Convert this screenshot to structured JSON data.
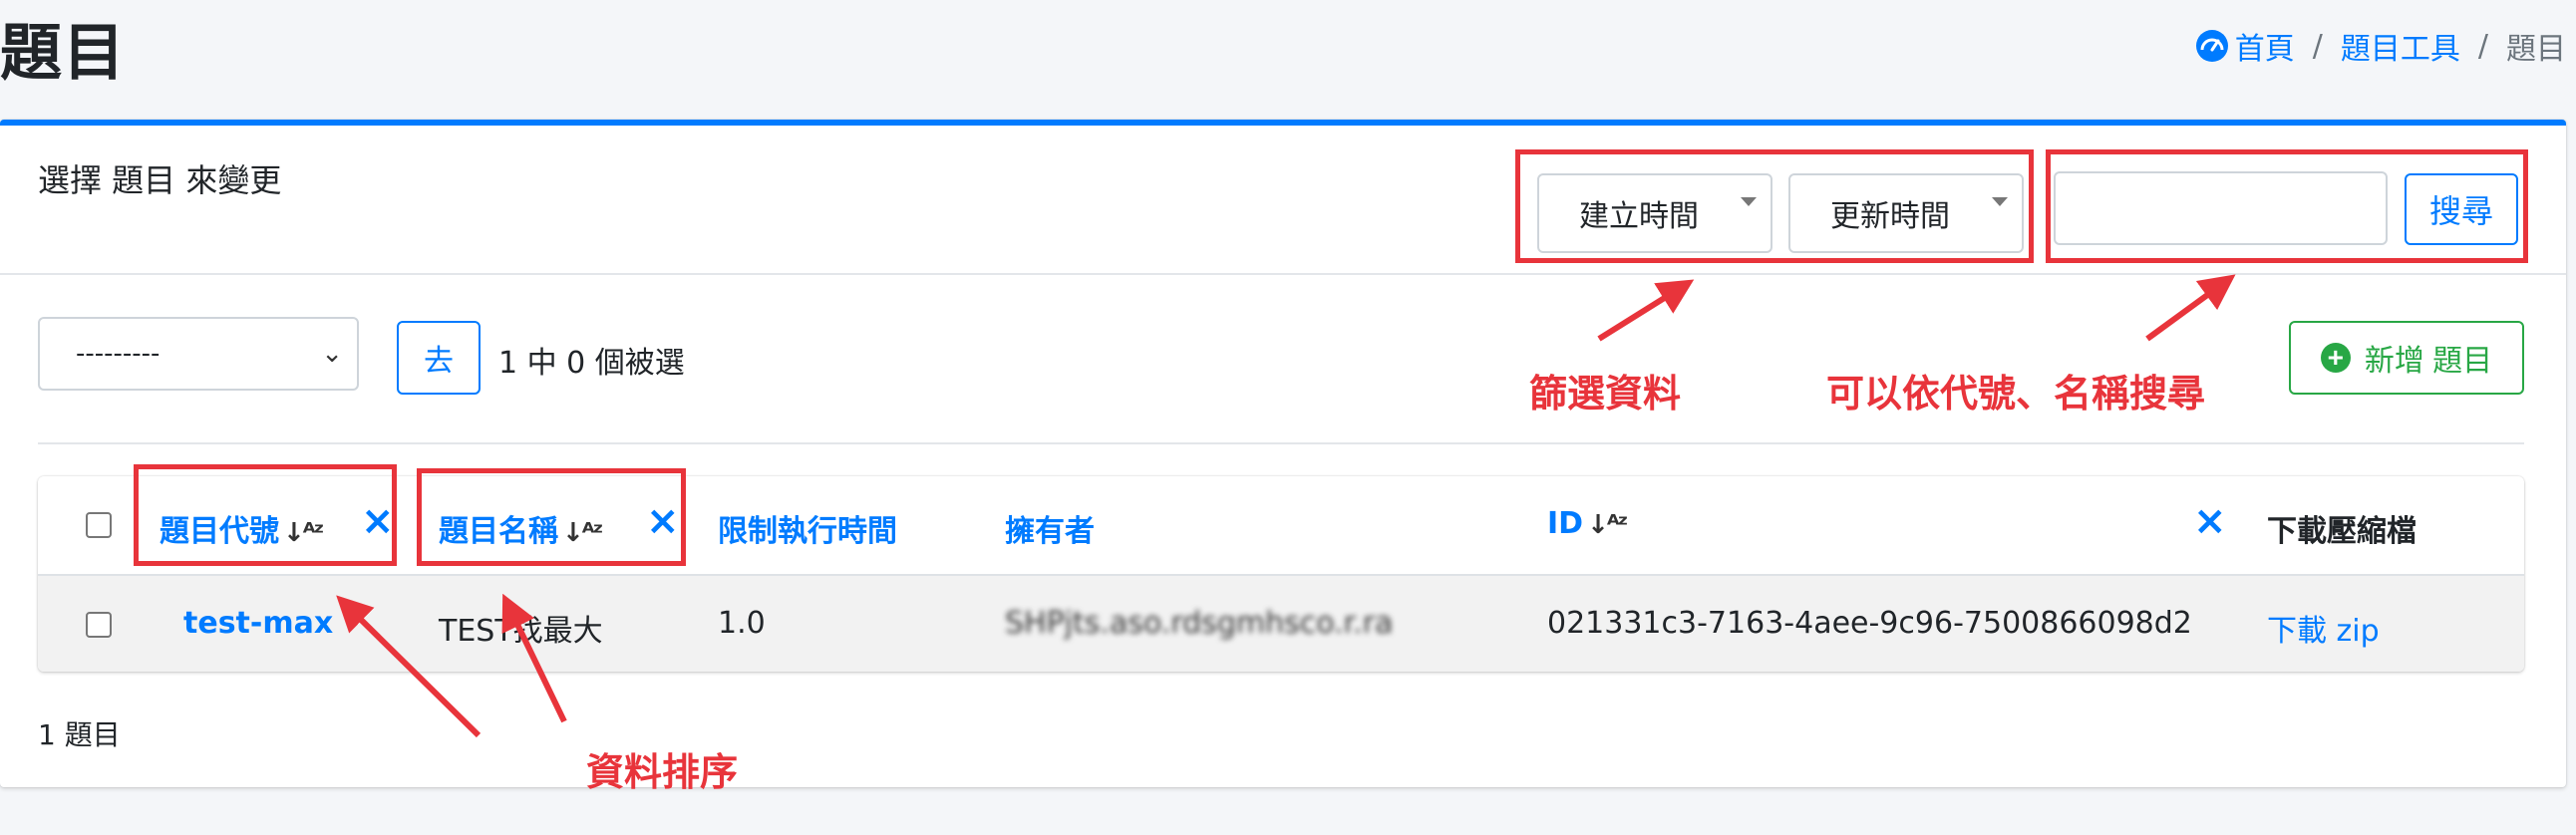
{
  "page": {
    "title": "題目"
  },
  "breadcrumb": {
    "home": "首頁",
    "sep1": "/",
    "tools": "題目工具",
    "sep2": "/",
    "current": "題目"
  },
  "card": {
    "title": "選擇 題目 來變更",
    "filters": [
      {
        "label": "建立時間"
      },
      {
        "label": "更新時間"
      }
    ],
    "search": {
      "value": "",
      "button_label": "搜尋"
    },
    "actions": {
      "select_value": "---------",
      "go_label": "去",
      "selected_count_text": "1 中 0 個被選",
      "add_label": "新增 題目"
    }
  },
  "table": {
    "columns": {
      "code": "題目代號",
      "name": "題目名稱",
      "time_limit": "限制執行時間",
      "owner": "擁有者",
      "id": "ID",
      "download": "下載壓縮檔"
    },
    "rows": [
      {
        "code": "test-max",
        "name": "TEST找最大",
        "time_limit": "1.0",
        "owner": "SHPjts.aso.rdsgmhsco.r.ra",
        "id": "021331c3-7163-4aee-9c96-7500866098d2",
        "download": "下載 zip"
      }
    ],
    "footer_count": "1 題目"
  },
  "annotations": {
    "filter_label": "篩選資料",
    "search_label": "可以依代號、名稱搜尋",
    "sort_label": "資料排序",
    "color": "#e8343b"
  },
  "colors": {
    "accent": "#007bff",
    "success": "#28a745",
    "annotation": "#e8343b"
  }
}
